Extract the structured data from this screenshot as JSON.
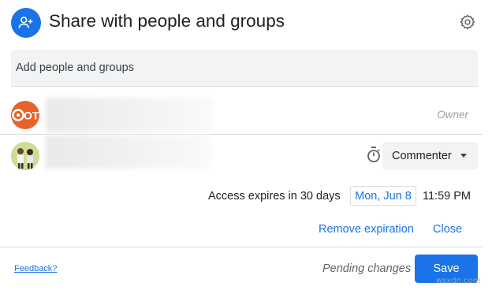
{
  "header": {
    "title": "Share with people and groups",
    "icon": "add-person-icon",
    "settings_icon": "gear-icon"
  },
  "add_people": {
    "placeholder": "Add people and groups"
  },
  "people": [
    {
      "avatar_text": "OTT",
      "role_label": "Owner"
    },
    {
      "role": "Commenter",
      "timer_icon": "timer-icon"
    }
  ],
  "expiration": {
    "text": "Access expires in 30 days",
    "date": "Mon, Jun 8",
    "time": "11:59 PM",
    "remove_label": "Remove expiration",
    "close_label": "Close"
  },
  "footer": {
    "feedback_label": "Feedback?",
    "pending_label": "Pending changes",
    "save_label": "Save"
  },
  "watermark": "wsxdn.com",
  "colors": {
    "accent": "#1a73e8",
    "owner_avatar": "#e8622a",
    "input_bg": "#f1f3f4"
  }
}
